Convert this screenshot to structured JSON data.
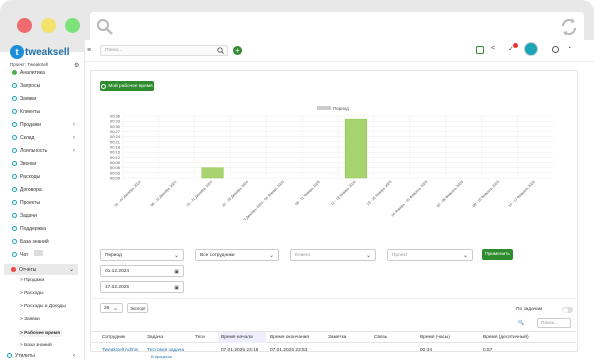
{
  "search": {
    "placeholder": "Поиск..."
  },
  "sidebar": {
    "logo": "tweaksell",
    "project": "Проект: TweakSell",
    "items": [
      {
        "label": "Аналитика",
        "active": true
      },
      {
        "label": "Запросы"
      },
      {
        "label": "Заявки"
      },
      {
        "label": "Клиенты"
      },
      {
        "label": "Продажи",
        "chev": "‹"
      },
      {
        "label": "Склад",
        "chev": "‹"
      },
      {
        "label": "Лояльность",
        "chev": "‹"
      },
      {
        "label": "Звонки"
      },
      {
        "label": "Расходы"
      },
      {
        "label": "Договора"
      },
      {
        "label": "Проекты"
      },
      {
        "label": "Задачи"
      },
      {
        "label": "Поддержка"
      },
      {
        "label": "База знаний"
      },
      {
        "label": "Чат"
      }
    ],
    "reports": {
      "label": "Отчеты",
      "subitems": [
        "> Продажи",
        "> Расходы",
        "> Расходы и Доходы",
        "> Заявки",
        "> Рабочее время",
        "> База знаний"
      ]
    },
    "utilities": "Утилиты"
  },
  "report": {
    "my_time_button": "Мой рабочее время",
    "legend": "Период",
    "y_ticks": [
      "00:36",
      "00:33",
      "00:30",
      "00:27",
      "00:24",
      "00:21",
      "00:18",
      "00:15",
      "00:12",
      "00:09",
      "00:06",
      "00:03",
      "00:00"
    ],
    "filters": {
      "period": "Период",
      "employees": "Все сотрудники",
      "client": "Клиент",
      "project": "Проект",
      "apply": "Применить",
      "date_from": "01.12.2024",
      "date_to": "17.02.2025"
    },
    "table": {
      "page_size": "25",
      "export": "Экспорт",
      "by_task": "По задачам",
      "search_placeholder": "Поиск...",
      "headers": [
        "Сотрудник",
        "Задача",
        "Теги",
        "Время начала",
        "Время окончания",
        "Заметка",
        "Связь",
        "Время (часы)",
        "Время (десятичный)"
      ],
      "row": [
        "TweakSell Admin",
        "Тестовая задача",
        "",
        "07.01.2025 23:19",
        "07.01.2025 23:53",
        "",
        "",
        "00:34",
        "0.57"
      ],
      "row_sub": "В процессе"
    }
  },
  "chart_data": {
    "type": "bar",
    "categories": [
      "01 - 07 Декабрь 2024",
      "08 - 14 Декабрь 2024",
      "15 - 21 Декабрь 2024",
      "22 - 28 Декабрь 2024",
      "29 Декабрь 2024 - 04 Январь 2025",
      "05 - 11 Январь 2025",
      "12 - 18 Январь 2025",
      "19 - 25 Январь 2025",
      "26 Январь - 01 Февраль 2025",
      "02 - 08 Февраль 2025",
      "09 - 15 Февраль 2025",
      "16 - 17 Февраль 2025"
    ],
    "series": [
      {
        "name": "Период",
        "values": [
          0,
          0,
          0.1,
          0,
          0,
          0,
          0.57,
          0,
          0,
          0,
          0,
          0
        ]
      }
    ],
    "ylabel": "",
    "ylim": [
      0,
      0.6
    ],
    "color": "#a8d46f"
  },
  "colors": {
    "accent": "#2e8b2e",
    "bar": "#a8d46f",
    "brand": "#1d8fd8"
  }
}
